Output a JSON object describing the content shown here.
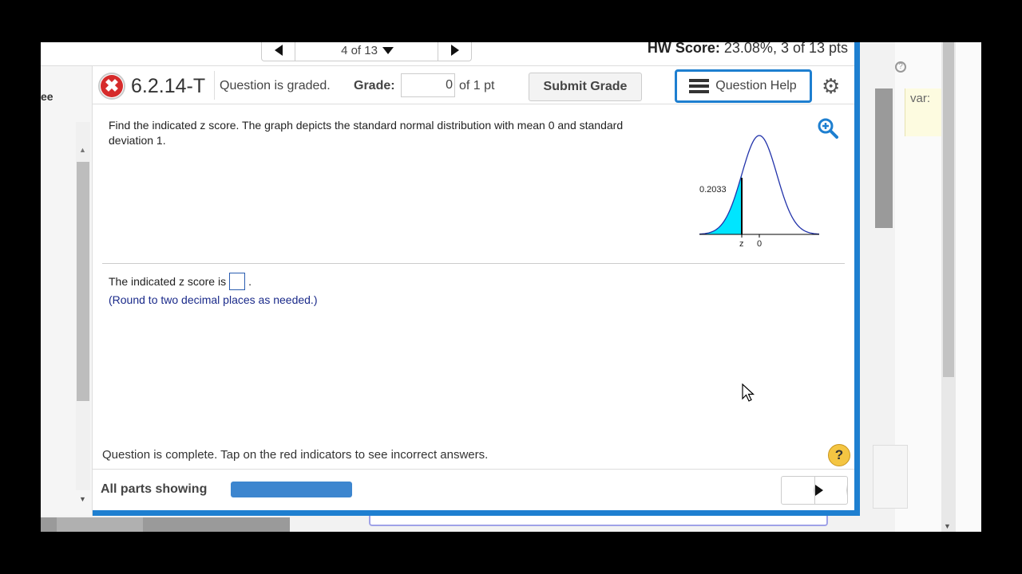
{
  "nav": {
    "position": "4 of 13",
    "hw_score_label": "HW Score:",
    "hw_score_value": "23.08%, 3 of 13 pts"
  },
  "header": {
    "question_id": "6.2.14-T",
    "status": "Question is graded.",
    "grade_label": "Grade:",
    "grade_value": "0",
    "grade_of": "of 1 pt",
    "submit_label": "Submit Grade",
    "help_label": "Question Help"
  },
  "question": {
    "prompt": "Find the indicated z score. The graph depicts the standard normal distribution with mean 0 and standard deviation 1.",
    "graph": {
      "area_label": "0.2033",
      "z_label": "z",
      "zero_label": "0",
      "shade_color": "#00e5ff"
    },
    "answer_prefix": "The indicated z score is",
    "answer_suffix": ".",
    "answer_value": "",
    "round_note": "(Round to two decimal places as needed.)",
    "complete_message": "Question is complete. Tap on the red indicators to see incorrect answers.",
    "help_glyph": "?"
  },
  "footer": {
    "parts_label": "All parts showing",
    "progress_fraction": 1.0
  },
  "background": {
    "left_fragment": "ee",
    "right_fragment": "var:"
  },
  "colors": {
    "accent": "#1e7fd0",
    "error": "#d62b2b",
    "progress": "#3d86cf"
  }
}
